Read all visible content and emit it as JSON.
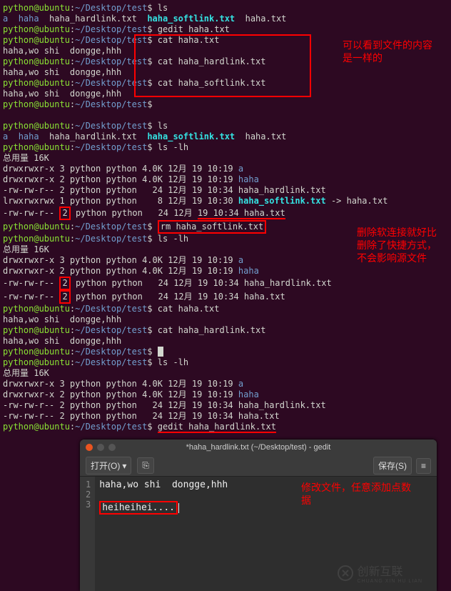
{
  "prompt": {
    "user": "python@ubuntu",
    "sep1": ":",
    "path": "~/Desktop/test",
    "sep2": "$ "
  },
  "lines": [
    {
      "type": "cmd",
      "cmd": "ls"
    },
    {
      "type": "ls1",
      "a": "a",
      "haha": "haha",
      "hl": "haha_hardlink.txt",
      "sl": "haha_softlink.txt",
      "txt": "haha.txt"
    },
    {
      "type": "cmd",
      "cmd": "gedit haha.txt"
    },
    {
      "type": "cmd_boxstart",
      "cmd": "cat haha.txt"
    },
    {
      "type": "out",
      "text": "haha,wo shi  dongge,hhh"
    },
    {
      "type": "cmd_inbox",
      "cmd": "cat haha_hardlink.txt"
    },
    {
      "type": "out",
      "text": "haha,wo shi  dongge,hhh"
    },
    {
      "type": "cmd_boxend",
      "cmd": "cat haha_softlink.txt"
    },
    {
      "type": "out",
      "text": "haha,wo shi  dongge,hhh"
    },
    {
      "type": "cmd",
      "cmd": ""
    },
    {
      "type": "blank"
    },
    {
      "type": "cmd",
      "cmd": "ls"
    },
    {
      "type": "ls1",
      "a": "a",
      "haha": "haha",
      "hl": "haha_hardlink.txt",
      "sl": "haha_softlink.txt",
      "txt": "haha.txt"
    },
    {
      "type": "cmd",
      "cmd": "ls -lh"
    },
    {
      "type": "out",
      "text": "总用量 16K"
    },
    {
      "type": "ll",
      "perm": "drwxrwxr-x",
      "n": "3",
      "rest": "python python 4.0K 12月 19 10:19",
      "name": "a",
      "cls": "blue"
    },
    {
      "type": "ll",
      "perm": "drwxrwxr-x",
      "n": "2",
      "rest": "python python 4.0K 12月 19 10:19",
      "name": "haha",
      "cls": "blue"
    },
    {
      "type": "ll",
      "perm": "-rw-rw-r--",
      "n": "2",
      "rest": "python python   24 12月 19 10:34",
      "name": "haha_hardlink.txt",
      "cls": "white"
    },
    {
      "type": "ll_link",
      "perm": "lrwxrwxrwx",
      "n": "1",
      "rest": "python python    8 12月 19 10:30",
      "name": "haha_softlink.txt",
      "target": "haha.txt"
    },
    {
      "type": "ll_box_row",
      "perm": "-rw-rw-r--",
      "n": "2",
      "rest": "python python   24 12月",
      "suffix": "19 10:34 haha.txt"
    },
    {
      "type": "cmd_redbox",
      "cmd": "rm haha_softlink.txt"
    },
    {
      "type": "cmd",
      "cmd": "ls -lh"
    },
    {
      "type": "out",
      "text": "总用量 16K"
    },
    {
      "type": "ll",
      "perm": "drwxrwxr-x",
      "n": "3",
      "rest": "python python 4.0K 12月 19 10:19",
      "name": "a",
      "cls": "blue"
    },
    {
      "type": "ll",
      "perm": "drwxrwxr-x",
      "n": "2",
      "rest": "python python 4.0K 12月 19 10:19",
      "name": "haha",
      "cls": "blue"
    },
    {
      "type": "ll_box",
      "perm": "-rw-rw-r--",
      "n": "2",
      "rest": "python python   24 12月 19 10:34",
      "name": "haha_hardlink.txt",
      "cls": "white"
    },
    {
      "type": "ll_box",
      "perm": "-rw-rw-r--",
      "n": "2",
      "rest": "python python   24 12月 19 10:34",
      "name": "haha.txt",
      "cls": "white"
    },
    {
      "type": "cmd",
      "cmd": "cat haha.txt"
    },
    {
      "type": "out",
      "text": "haha,wo shi  dongge,hhh"
    },
    {
      "type": "cmd",
      "cmd": "cat haha_hardlink.txt"
    },
    {
      "type": "out",
      "text": "haha,wo shi  dongge,hhh"
    },
    {
      "type": "cmd_cursor",
      "cmd": ""
    },
    {
      "type": "cmd",
      "cmd": "ls -lh"
    },
    {
      "type": "out",
      "text": "总用量 16K"
    },
    {
      "type": "ll",
      "perm": "drwxrwxr-x",
      "n": "3",
      "rest": "python python 4.0K 12月 19 10:19",
      "name": "a",
      "cls": "blue"
    },
    {
      "type": "ll",
      "perm": "drwxrwxr-x",
      "n": "2",
      "rest": "python python 4.0K 12月 19 10:19",
      "name": "haha",
      "cls": "blue"
    },
    {
      "type": "ll",
      "perm": "-rw-rw-r--",
      "n": "2",
      "rest": "python python   24 12月 19 10:34",
      "name": "haha_hardlink.txt",
      "cls": "white"
    },
    {
      "type": "ll",
      "perm": "-rw-rw-r--",
      "n": "2",
      "rest": "python python   24 12月 19 10:34",
      "name": "haha.txt",
      "cls": "white"
    },
    {
      "type": "cmd_underline",
      "cmd": "gedit haha_hardlink.txt"
    }
  ],
  "annotations": {
    "a1": "可以看到文件的内容是一样的",
    "a2": "删除软连接就好比删除了快捷方式，不会影响源文件",
    "a3": "修改文件，任意添加点数据"
  },
  "gedit": {
    "title": "*haha_hardlink.txt (~/Desktop/test) - gedit",
    "open_btn": "打开(O)",
    "save_btn": "保存(S)",
    "gutter": [
      "1",
      "2",
      "3"
    ],
    "editor_lines": [
      "haha,wo shi  dongge,hhh",
      "",
      "heiheihei...."
    ]
  },
  "watermark": {
    "text": "创新互联",
    "sub": "CHUANG XIN HU LIAN"
  }
}
